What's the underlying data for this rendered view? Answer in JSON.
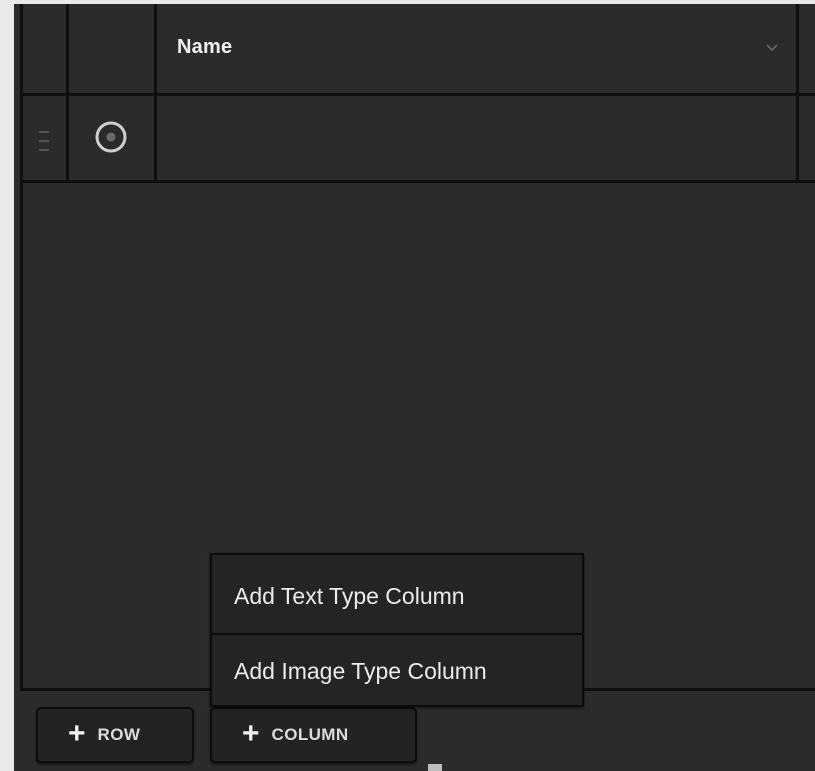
{
  "table": {
    "header": {
      "name_column_label": "Name",
      "sort_icon": "chevron-down-icon"
    },
    "rows": [
      {
        "handle_icon": "drag-handle-icon",
        "select_icon": "radio-button-icon",
        "name": ""
      }
    ]
  },
  "add_column_menu": {
    "items": [
      {
        "label": "Add Text Type Column"
      },
      {
        "label": "Add Image Type Column"
      }
    ]
  },
  "footer": {
    "add_row_label": "ROW",
    "add_column_label": "COLUMN",
    "plus_icon": "plus-icon"
  },
  "colors": {
    "panel_background": "#2b2b2b",
    "grid_line": "#0f0f0f",
    "menu_background": "#222426",
    "text": "#f2f2f2"
  }
}
